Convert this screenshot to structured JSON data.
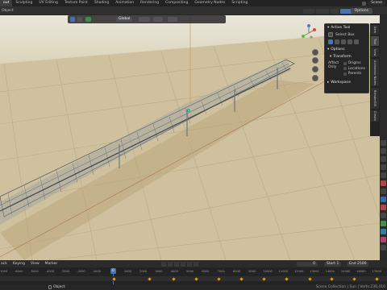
{
  "topbar": {
    "tabs": [
      {
        "label": "out",
        "active": true
      },
      {
        "label": "Sculpting",
        "active": false
      },
      {
        "label": "UV Editing",
        "active": false
      },
      {
        "label": "Texture Paint",
        "active": false
      },
      {
        "label": "Shading",
        "active": false
      },
      {
        "label": "Animation",
        "active": false
      },
      {
        "label": "Rendering",
        "active": false
      },
      {
        "label": "Compositing",
        "active": false
      },
      {
        "label": "Geometry Nodes",
        "active": false
      },
      {
        "label": "Scripting",
        "active": false
      }
    ],
    "scene": "Scene"
  },
  "header": {
    "mode_label": "Object",
    "options_label": "Options"
  },
  "toolbar": {
    "orientation": "Global"
  },
  "npanel": {
    "active_tool_title": "Active Tool",
    "select_label": "Select Box",
    "options_title": "Options",
    "transform_title": "Transform",
    "affect_label": "Affect Only",
    "affect_items": [
      "Origins",
      "Locations",
      "Parents"
    ],
    "workspace_title": "Workspace"
  },
  "vtabs": [
    "Item",
    "Tool",
    "View",
    "Animation Nodes",
    "BlenderGIS",
    "Create"
  ],
  "timeline": {
    "menus": [
      "ack",
      "Keying",
      "View",
      "Marker"
    ],
    "current_frame": "0",
    "start_label": "Start",
    "start_value": "1",
    "end_label": "End",
    "end_value": "2500",
    "current_marker": "0",
    "ticks": [
      "-1500",
      "-1000",
      "-500",
      "0",
      "500",
      "1000",
      "1500",
      "2000",
      "2500",
      "3000",
      "3500",
      "4000",
      "4500",
      "5000",
      "5500",
      "6000",
      "6500",
      "7000",
      "7500",
      "8000",
      "8500",
      "9000",
      "9500",
      "10000"
    ],
    "tick_labels_visible": [
      "-7000",
      "-6000",
      "-5000",
      "-4000",
      "-3000",
      "-2000",
      "-1000",
      "0",
      "1000",
      "2000",
      "3000",
      "4000",
      "5000",
      "6000",
      "7000",
      "8000",
      "9000",
      "10000",
      "11000",
      "12000",
      "13000",
      "14000",
      "15000",
      "16000",
      "17000"
    ]
  },
  "status": {
    "left": "Object",
    "right": "Scene Collection | Sun | Verts:236,416"
  },
  "colors": {
    "accent": "#4772b3",
    "ground": "#cfc19d",
    "grid": "#b8aa86",
    "keyframe": "#e5a100"
  }
}
